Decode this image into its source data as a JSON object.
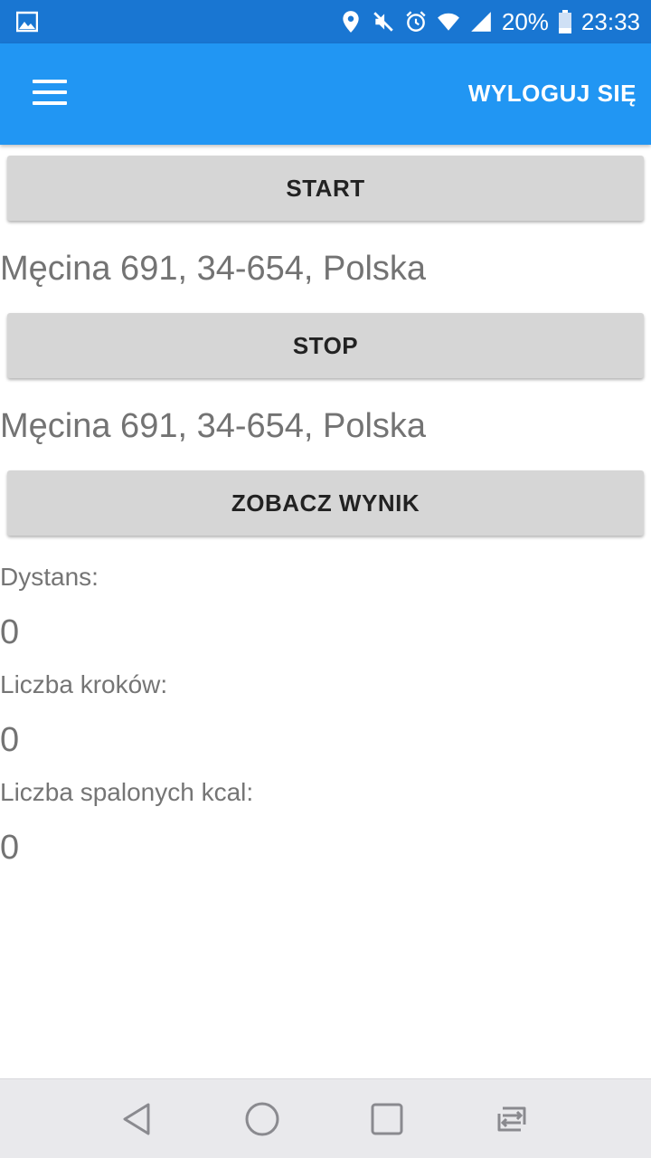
{
  "status_bar": {
    "battery": "20%",
    "time": "23:33",
    "icons": [
      "image-icon",
      "location-icon",
      "mute-icon",
      "alarm-icon",
      "wifi-icon",
      "signal-icon",
      "battery-icon"
    ]
  },
  "app_bar": {
    "menu_icon": "hamburger-menu-icon",
    "logout_label": "WYLOGUJ SIĘ",
    "color": "#2196f3"
  },
  "main": {
    "start_button": "START",
    "start_address": "Męcina 691, 34-654, Polska",
    "stop_button": "STOP",
    "stop_address": "Męcina 691, 34-654, Polska",
    "result_button": "ZOBACZ WYNIK",
    "distance_label": "Dystans:",
    "distance_value": "0",
    "steps_label": "Liczba kroków:",
    "steps_value": "0",
    "kcal_label": "Liczba spalonych kcal:",
    "kcal_value": "0"
  },
  "nav_bar": {
    "icons": [
      "back-icon",
      "home-icon",
      "recents-icon",
      "switch-apps-icon"
    ]
  }
}
